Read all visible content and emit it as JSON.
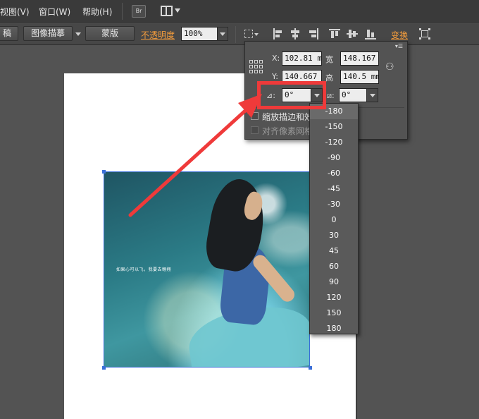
{
  "menubar": {
    "items": [
      "视图(V)",
      "窗口(W)",
      "帮助(H)"
    ],
    "bridge_label": "Br"
  },
  "controlbar": {
    "left_cut_label": "稿",
    "image_trace_label": "图像描摹",
    "mask_label": "蒙版",
    "opacity_label": "不透明度",
    "opacity_value": "100%",
    "transform_link": "变换"
  },
  "transform_panel": {
    "x_label": "X:",
    "x_value": "102.81 m",
    "y_label": "Y:",
    "y_value": "140.667",
    "w_label": "宽",
    "w_value": "148.167",
    "h_label": "高",
    "h_value": "140.5 mm",
    "rotate_value": "0°",
    "shear_value": "0°",
    "scale_strokes_label": "缩放描边和效",
    "align_pixel_label": "对齐像素网格"
  },
  "angle_options": [
    "-180",
    "-150",
    "-120",
    "-90",
    "-60",
    "-45",
    "-30",
    "0",
    "30",
    "45",
    "60",
    "90",
    "120",
    "150",
    "180"
  ],
  "photo": {
    "caption": "如果心可以飞，我要去翱翔"
  },
  "colors": {
    "highlight": "#ef3a3a",
    "link_orange": "#f39c3c",
    "selection": "#3a6fd8"
  }
}
